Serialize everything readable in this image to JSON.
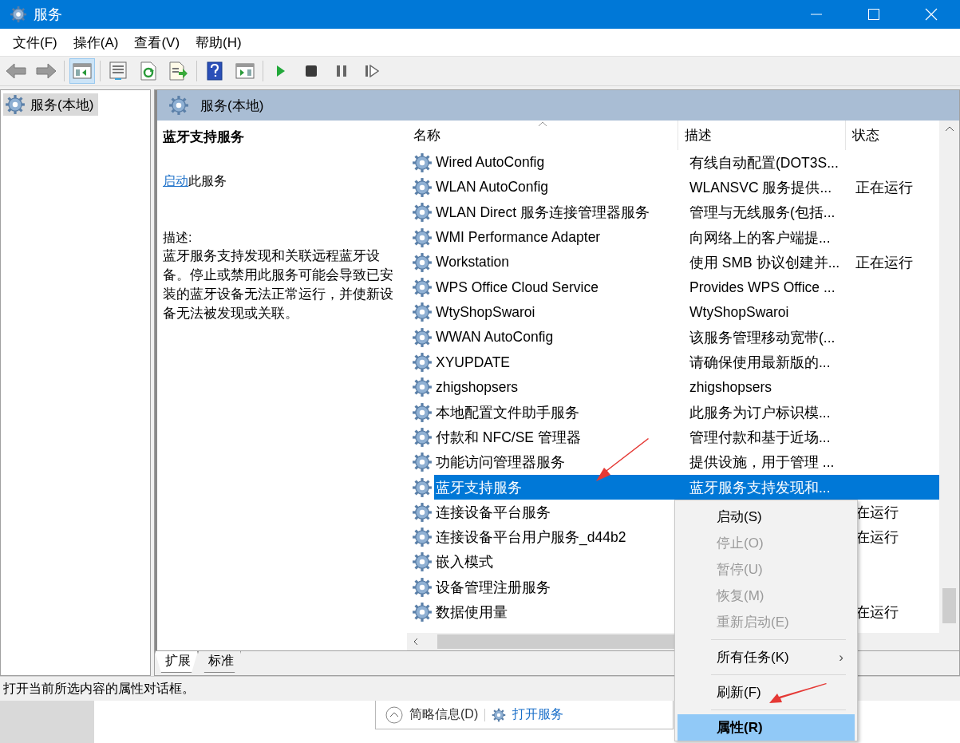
{
  "window": {
    "title": "服务",
    "controls": [
      {
        "kind": "minimize"
      },
      {
        "kind": "maximize"
      },
      {
        "kind": "close"
      }
    ]
  },
  "menu": [
    "文件(F)",
    "操作(A)",
    "查看(V)",
    "帮助(H)"
  ],
  "toolbar": [
    {
      "kind": "back",
      "pressed": false
    },
    {
      "kind": "forward",
      "pressed": false
    },
    {
      "kind": "separator"
    },
    {
      "kind": "tree",
      "pressed": true
    },
    {
      "kind": "separator"
    },
    {
      "kind": "properties",
      "pressed": false
    },
    {
      "kind": "refresh",
      "pressed": false
    },
    {
      "kind": "export",
      "pressed": false
    },
    {
      "kind": "separator"
    },
    {
      "kind": "help",
      "pressed": false
    },
    {
      "kind": "action-pane",
      "pressed": false
    },
    {
      "kind": "separator"
    },
    {
      "kind": "play",
      "pressed": false
    },
    {
      "kind": "stop",
      "pressed": false
    },
    {
      "kind": "pause",
      "pressed": false
    },
    {
      "kind": "resume",
      "pressed": false
    }
  ],
  "tree": {
    "items": [
      {
        "label": "服务(本地)",
        "selected": true
      }
    ]
  },
  "panel": {
    "title": "服务(本地)",
    "service_name": "蓝牙支持服务",
    "action": {
      "link": "启动",
      "text": "此服务"
    },
    "description_label": "描述:",
    "description": "蓝牙服务支持发现和关联远程蓝牙设备。停止或禁用此服务可能会导致已安装的蓝牙设备无法正常运行，并使新设备无法被发现或关联。"
  },
  "table": {
    "columns": [
      "名称",
      "描述",
      "状态"
    ],
    "rows": [
      {
        "name": "Wired AutoConfig",
        "description": "有线自动配置(DOT3S...",
        "selected": false
      },
      {
        "name": "WLAN AutoConfig",
        "description": "WLANSVC 服务提供...",
        "status": "正在运行",
        "selected": false
      },
      {
        "name": "WLAN Direct 服务连接管理器服务",
        "description": "管理与无线服务(包括...",
        "selected": false
      },
      {
        "name": "WMI Performance Adapter",
        "description": "向网络上的客户端提...",
        "selected": false
      },
      {
        "name": "Workstation",
        "description": "使用 SMB 协议创建并...",
        "status": "正在运行",
        "selected": false
      },
      {
        "name": "WPS Office Cloud Service",
        "description": "Provides WPS Office ...",
        "selected": false
      },
      {
        "name": "WtyShopSwaroi",
        "description": "WtyShopSwaroi",
        "selected": false
      },
      {
        "name": "WWAN AutoConfig",
        "description": "该服务管理移动宽带(...",
        "selected": false
      },
      {
        "name": "XYUPDATE",
        "description": "请确保使用最新版的...",
        "selected": false
      },
      {
        "name": "zhigshopsers",
        "description": "zhigshopsers",
        "selected": false
      },
      {
        "name": "本地配置文件助手服务",
        "description": "此服务为订户标识模...",
        "selected": false
      },
      {
        "name": "付款和 NFC/SE 管理器",
        "description": "管理付款和基于近场...",
        "selected": false
      },
      {
        "name": "功能访问管理器服务",
        "description": "提供设施，用于管理 ...",
        "selected": false
      },
      {
        "name": "蓝牙支持服务",
        "description": "蓝牙服务支持发现和...",
        "selected": true
      },
      {
        "name": "连接设备平台服务",
        "status": "在运行",
        "selected": false
      },
      {
        "name": "连接设备平台用户服务_d44b2",
        "status": "在运行",
        "selected": false
      },
      {
        "name": "嵌入模式",
        "selected": false
      },
      {
        "name": "设备管理注册服务",
        "selected": false
      },
      {
        "name": "数据使用量",
        "status": "在运行",
        "selected": false
      }
    ]
  },
  "view_tabs": [
    {
      "label": "扩展",
      "selected": true
    },
    {
      "label": "标准",
      "selected": false
    }
  ],
  "status_bar": "打开当前所选内容的属性对话框。",
  "background_window": {
    "button": "简略信息(D)",
    "link": "打开服务"
  },
  "context_menu": [
    {
      "kind": "item",
      "label": "启动(S)",
      "disabled": false,
      "selected": false
    },
    {
      "kind": "item",
      "label": "停止(O)",
      "disabled": true,
      "selected": false
    },
    {
      "kind": "item",
      "label": "暂停(U)",
      "disabled": true,
      "selected": false
    },
    {
      "kind": "item",
      "label": "恢复(M)",
      "disabled": true,
      "selected": false
    },
    {
      "kind": "item",
      "label": "重新启动(E)",
      "disabled": true,
      "selected": false
    },
    {
      "kind": "separator"
    },
    {
      "kind": "submenu",
      "label": "所有任务(K)",
      "arrow": "›",
      "disabled": false,
      "selected": false
    },
    {
      "kind": "separator"
    },
    {
      "kind": "item",
      "label": "刷新(F)",
      "disabled": false,
      "selected": false
    },
    {
      "kind": "separator"
    },
    {
      "kind": "item",
      "label": "属性(R)",
      "disabled": false,
      "selected": true
    }
  ]
}
